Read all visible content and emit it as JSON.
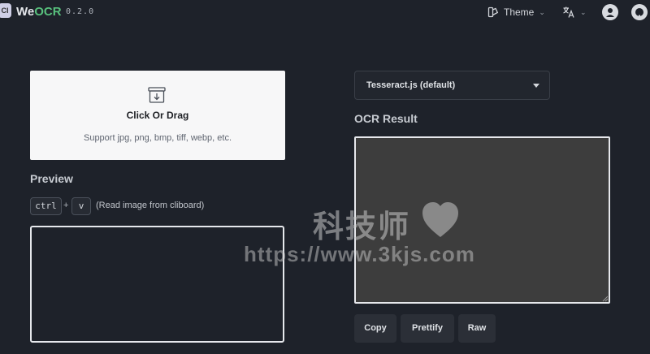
{
  "header": {
    "logo_text": "CI",
    "brand_we": "We",
    "brand_ocr": "OCR",
    "version": "0.2.0",
    "theme_label": "Theme",
    "lang_icon": "translate-icon",
    "user_icon": "user-icon",
    "github_icon": "github-icon"
  },
  "upload": {
    "title": "Click Or Drag",
    "subtitle": "Support jpg, png, bmp, tiff, webp, etc."
  },
  "preview": {
    "title": "Preview",
    "key1": "ctrl",
    "plus": "+",
    "key2": "v",
    "hint": "(Read image from cliboard)"
  },
  "ocr": {
    "engine_selected": "Tesseract.js (default)",
    "result_title": "OCR Result",
    "result_text": "",
    "buttons": {
      "copy": "Copy",
      "prettify": "Prettify",
      "raw": "Raw"
    }
  },
  "watermark": {
    "line1": "科技师",
    "line2": "https://www.3kjs.com"
  },
  "colors": {
    "background": "#1e222a",
    "brand_green": "#58c17d",
    "upload_bg": "#f7f7f8",
    "result_bg": "#3d3d3d"
  }
}
